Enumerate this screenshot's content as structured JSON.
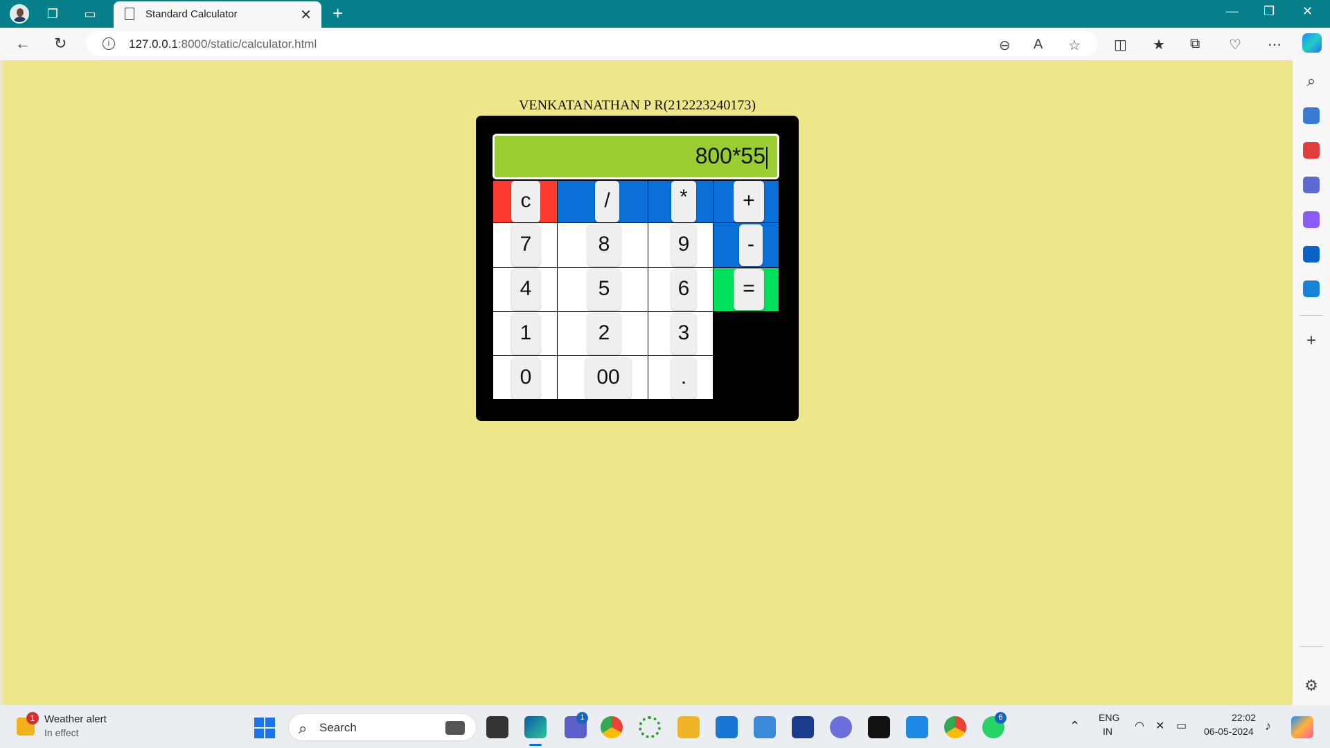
{
  "browser": {
    "tab_title": "Standard Calculator",
    "url_host": "127.0.0.1",
    "url_rest": ":8000/static/calculator.html"
  },
  "page": {
    "header": "VENKATANATHAN P R(212223240173)",
    "display_value": "800*55"
  },
  "calculator": {
    "colors": {
      "background": "#eee68a",
      "body": "#000000",
      "display": "#9acd32",
      "clear_row": "#ff3b30",
      "operator": "#0a6fd6",
      "equals": "#00e05a",
      "number_cell": "#ffffff",
      "key": "#efefef"
    },
    "keys": {
      "clear": "c",
      "divide": "/",
      "multiply": "*",
      "plus": "+",
      "seven": "7",
      "eight": "8",
      "nine": "9",
      "minus": "-",
      "four": "4",
      "five": "5",
      "six": "6",
      "equals": "=",
      "one": "1",
      "two": "2",
      "three": "3",
      "zero": "0",
      "double_zero": "00",
      "dot": "."
    }
  },
  "taskbar": {
    "weather_title": "Weather alert",
    "weather_sub": "In effect",
    "weather_badge": "1",
    "search_label": "Search",
    "teams_badge": "1",
    "whatsapp_badge": "6",
    "lang_top": "ENG",
    "lang_bottom": "IN",
    "time": "22:02",
    "date": "06-05-2024"
  }
}
